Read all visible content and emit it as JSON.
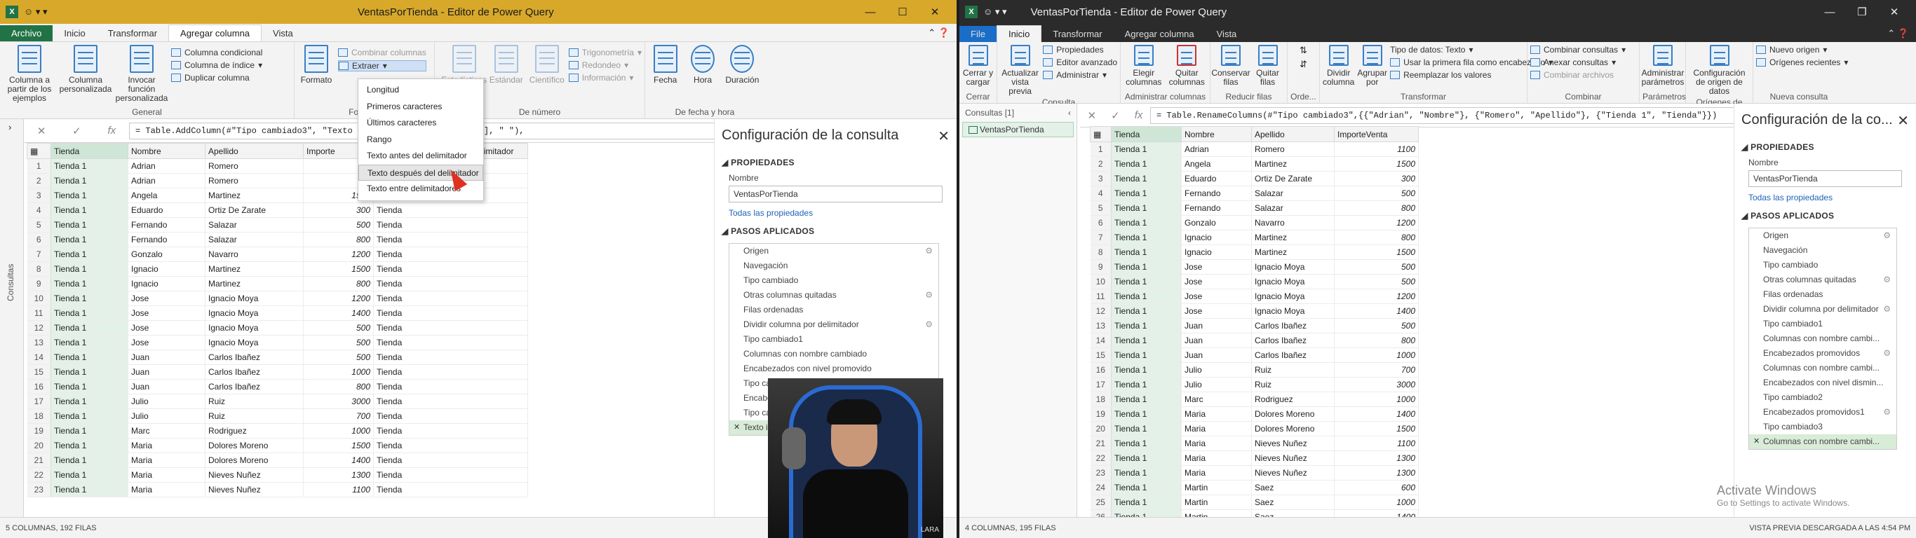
{
  "left": {
    "title": "VentasPorTienda - Editor de Power Query",
    "menu": [
      "Archivo",
      "Inicio",
      "Transformar",
      "Agregar columna",
      "Vista"
    ],
    "ribbon": {
      "general": {
        "label": "General",
        "big": [
          "Columna a partir de los ejemplos",
          "Columna personalizada",
          "Invocar función personalizada"
        ],
        "small": [
          "Columna condicional",
          "Columna de índice",
          "Duplicar columna"
        ]
      },
      "texto": {
        "label": "Formato",
        "combine": "Combinar columnas",
        "extract": "Extraer",
        "big": "Formato"
      },
      "numero": {
        "label": "De número",
        "items": [
          "Estadísticas",
          "Estándar",
          "Científico"
        ],
        "small": [
          "Trigonometría",
          "Redondeo",
          "Información"
        ]
      },
      "fecha": {
        "label": "De fecha y hora",
        "items": [
          "Fecha",
          "Hora",
          "Duración"
        ]
      }
    },
    "formula": "= Table.AddColumn(#\"Tipo cambiado3\", \"Texto                                                 t.BeforeDelimiter([Tienda], \" \"),",
    "queries_label": "Consultas",
    "extract_menu": [
      "Longitud",
      "Primeros caracteres",
      "Últimos caracteres",
      "Rango",
      "Texto antes del delimitador",
      "Texto después del delimitador",
      "Texto entre delimitadores"
    ],
    "columns": [
      "Tienda",
      "Nombre",
      "Apellido",
      "Importe",
      "Texto insertado antes del delimitador"
    ],
    "rows": [
      [
        "Tienda 1",
        "Adrian",
        "Romero",
        "",
        "Tienda"
      ],
      [
        "Tienda 1",
        "Adrian",
        "Romero",
        "",
        "Tienda"
      ],
      [
        "Tienda 1",
        "Angela",
        "Martinez",
        "1500",
        "Tienda"
      ],
      [
        "Tienda 1",
        "Eduardo",
        "Ortiz De Zarate",
        "300",
        "Tienda"
      ],
      [
        "Tienda 1",
        "Fernando",
        "Salazar",
        "500",
        "Tienda"
      ],
      [
        "Tienda 1",
        "Fernando",
        "Salazar",
        "800",
        "Tienda"
      ],
      [
        "Tienda 1",
        "Gonzalo",
        "Navarro",
        "1200",
        "Tienda"
      ],
      [
        "Tienda 1",
        "Ignacio",
        "Martinez",
        "1500",
        "Tienda"
      ],
      [
        "Tienda 1",
        "Ignacio",
        "Martinez",
        "800",
        "Tienda"
      ],
      [
        "Tienda 1",
        "Jose",
        "Ignacio Moya",
        "1200",
        "Tienda"
      ],
      [
        "Tienda 1",
        "Jose",
        "Ignacio Moya",
        "1400",
        "Tienda"
      ],
      [
        "Tienda 1",
        "Jose",
        "Ignacio Moya",
        "500",
        "Tienda"
      ],
      [
        "Tienda 1",
        "Jose",
        "Ignacio Moya",
        "500",
        "Tienda"
      ],
      [
        "Tienda 1",
        "Juan",
        "Carlos Ibañez",
        "500",
        "Tienda"
      ],
      [
        "Tienda 1",
        "Juan",
        "Carlos Ibañez",
        "1000",
        "Tienda"
      ],
      [
        "Tienda 1",
        "Juan",
        "Carlos Ibañez",
        "800",
        "Tienda"
      ],
      [
        "Tienda 1",
        "Julio",
        "Ruiz",
        "3000",
        "Tienda"
      ],
      [
        "Tienda 1",
        "Julio",
        "Ruiz",
        "700",
        "Tienda"
      ],
      [
        "Tienda 1",
        "Marc",
        "Rodriguez",
        "1000",
        "Tienda"
      ],
      [
        "Tienda 1",
        "Maria",
        "Dolores Moreno",
        "1500",
        "Tienda"
      ],
      [
        "Tienda 1",
        "Maria",
        "Dolores Moreno",
        "1400",
        "Tienda"
      ],
      [
        "Tienda 1",
        "Maria",
        "Nieves Nuñez",
        "1300",
        "Tienda"
      ],
      [
        "Tienda 1",
        "Maria",
        "Nieves Nuñez",
        "1100",
        "Tienda"
      ]
    ],
    "settings": {
      "title": "Configuración de la consulta",
      "props": "PROPIEDADES",
      "name_label": "Nombre",
      "name": "VentasPorTienda",
      "all_props": "Todas las propiedades",
      "steps_label": "PASOS APLICADOS",
      "steps": [
        "Origen",
        "Navegación",
        "Tipo cambiado",
        "Otras columnas quitadas",
        "Filas ordenadas",
        "Dividir columna por delimitador",
        "Tipo cambiado1",
        "Columnas con nombre cambiado",
        "Encabezados con nivel promovido",
        "Tipo cambiado2",
        "Encabezados promovidos",
        "Tipo cambiado3",
        "Texto insertado antes del delimitador"
      ]
    },
    "status": "5 COLUMNAS, 192 FILAS",
    "webcam_label": "LARA"
  },
  "right": {
    "title": "VentasPorTienda - Editor de Power Query",
    "menu": [
      "File",
      "Inicio",
      "Transformar",
      "Agregar columna",
      "Vista"
    ],
    "ribbon": {
      "cerrar": {
        "label": "Cerrar",
        "big": "Cerrar y cargar"
      },
      "consulta": {
        "label": "Consulta",
        "big": "Actualizar vista previa",
        "small": [
          "Propiedades",
          "Editor avanzado",
          "Administrar"
        ]
      },
      "admin": {
        "label": "Administrar columnas",
        "items": [
          "Elegir columnas",
          "Quitar columnas"
        ]
      },
      "reducir": {
        "label": "Reducir filas",
        "items": [
          "Conservar filas",
          "Quitar filas"
        ]
      },
      "ordenar": {
        "label": "Orde..."
      },
      "transformar": {
        "label": "Transformar",
        "items": [
          "Dividir columna",
          "Agrupar por"
        ],
        "small": [
          "Tipo de datos: Texto",
          "Usar la primera fila como encabezado",
          "Reemplazar los valores"
        ]
      },
      "combinar": {
        "label": "Combinar",
        "small": [
          "Combinar consultas",
          "Anexar consultas",
          "Combinar archivos"
        ]
      },
      "parametros": {
        "label": "Parámetros",
        "big": "Administrar parámetros"
      },
      "origenes": {
        "label": "Orígenes de datos",
        "big": "Configuración de origen de datos"
      },
      "nueva": {
        "label": "Nueva consulta",
        "small": [
          "Nuevo origen",
          "Orígenes recientes"
        ]
      }
    },
    "formula": "= Table.RenameColumns(#\"Tipo cambiado3\",{{\"Adrian\", \"Nombre\"}, {\"Romero\", \"Apellido\"}, {\"Tienda 1\", \"Tienda\"}})",
    "queries_header": "Consultas [1]",
    "query_item": "VentasPorTienda",
    "columns": [
      "Tienda",
      "Nombre",
      "Apellido",
      "ImporteVenta"
    ],
    "rows": [
      [
        "Tienda 1",
        "Adrian",
        "Romero",
        "1100"
      ],
      [
        "Tienda 1",
        "Angela",
        "Martinez",
        "1500"
      ],
      [
        "Tienda 1",
        "Eduardo",
        "Ortiz De Zarate",
        "300"
      ],
      [
        "Tienda 1",
        "Fernando",
        "Salazar",
        "500"
      ],
      [
        "Tienda 1",
        "Fernando",
        "Salazar",
        "800"
      ],
      [
        "Tienda 1",
        "Gonzalo",
        "Navarro",
        "1200"
      ],
      [
        "Tienda 1",
        "Ignacio",
        "Martinez",
        "800"
      ],
      [
        "Tienda 1",
        "Ignacio",
        "Martinez",
        "1500"
      ],
      [
        "Tienda 1",
        "Jose",
        "Ignacio Moya",
        "500"
      ],
      [
        "Tienda 1",
        "Jose",
        "Ignacio Moya",
        "500"
      ],
      [
        "Tienda 1",
        "Jose",
        "Ignacio Moya",
        "1200"
      ],
      [
        "Tienda 1",
        "Jose",
        "Ignacio Moya",
        "1400"
      ],
      [
        "Tienda 1",
        "Juan",
        "Carlos Ibañez",
        "500"
      ],
      [
        "Tienda 1",
        "Juan",
        "Carlos Ibañez",
        "800"
      ],
      [
        "Tienda 1",
        "Juan",
        "Carlos Ibañez",
        "1000"
      ],
      [
        "Tienda 1",
        "Julio",
        "Ruiz",
        "700"
      ],
      [
        "Tienda 1",
        "Julio",
        "Ruiz",
        "3000"
      ],
      [
        "Tienda 1",
        "Marc",
        "Rodriguez",
        "1000"
      ],
      [
        "Tienda 1",
        "Maria",
        "Dolores Moreno",
        "1400"
      ],
      [
        "Tienda 1",
        "Maria",
        "Dolores Moreno",
        "1500"
      ],
      [
        "Tienda 1",
        "Maria",
        "Nieves Nuñez",
        "1100"
      ],
      [
        "Tienda 1",
        "Maria",
        "Nieves Nuñez",
        "1300"
      ],
      [
        "Tienda 1",
        "Maria",
        "Nieves Nuñez",
        "1300"
      ],
      [
        "Tienda 1",
        "Martin",
        "Saez",
        "600"
      ],
      [
        "Tienda 1",
        "Martin",
        "Saez",
        "1000"
      ],
      [
        "Tienda 1",
        "Martin",
        "Saez",
        "1400"
      ]
    ],
    "settings": {
      "title": "Configuración de la co...",
      "props": "PROPIEDADES",
      "name_label": "Nombre",
      "name": "VentasPorTienda",
      "all_props": "Todas las propiedades",
      "steps_label": "PASOS APLICADOS",
      "steps": [
        "Origen",
        "Navegación",
        "Tipo cambiado",
        "Otras columnas quitadas",
        "Filas ordenadas",
        "Dividir columna por delimitador",
        "Tipo cambiado1",
        "Columnas con nombre cambi...",
        "Encabezados promovidos",
        "Columnas con nombre cambi...",
        "Encabezados con nivel dismin...",
        "Tipo cambiado2",
        "Encabezados promovidos1",
        "Tipo cambiado3",
        "Columnas con nombre cambi..."
      ]
    },
    "status_left": "4 COLUMNAS, 195 FILAS",
    "status_right": "VISTA PREVIA DESCARGADA A LAS 4:54 PM",
    "activate_title": "Activate Windows",
    "activate_sub": "Go to Settings to activate Windows."
  },
  "colors": {
    "excel_green": "#217346",
    "title_gold": "#d7a82a",
    "highlight": "#e3f1e8"
  }
}
